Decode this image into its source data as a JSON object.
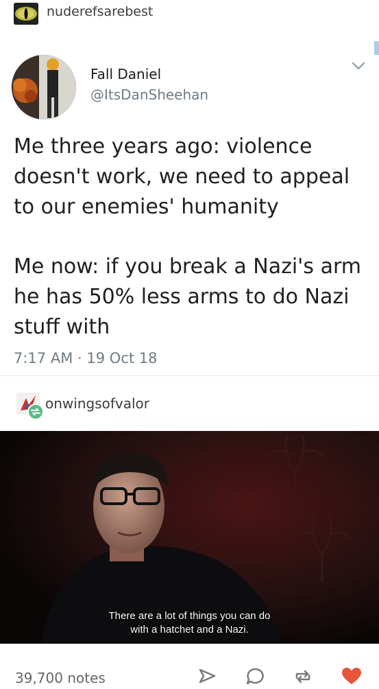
{
  "reblogger": {
    "username": "nuderefsarebest"
  },
  "tweet": {
    "display_name": "Fall Daniel",
    "handle": "@ItsDanSheehan",
    "paragraph_1": "Me three years ago: violence doesn't work, we need to appeal to our enemies' humanity",
    "paragraph_2": "Me now: if you break a Nazi's arm he has 50% less arms to do Nazi stuff with",
    "timestamp": "7:17 AM · 19 Oct 18"
  },
  "second_reblogger": {
    "username": "onwingsofvalor"
  },
  "image": {
    "caption_line_1": "There are a lot of things you can do",
    "caption_line_2": "with a hatchet and a Nazi."
  },
  "footer": {
    "notes": "39,700 notes",
    "icons": [
      "share-icon",
      "reply-icon",
      "reblog-icon",
      "like-icon"
    ]
  },
  "colors": {
    "like": "#e7543a",
    "reblog_badge": "#56bc8a",
    "text_muted": "#6f7b85"
  }
}
